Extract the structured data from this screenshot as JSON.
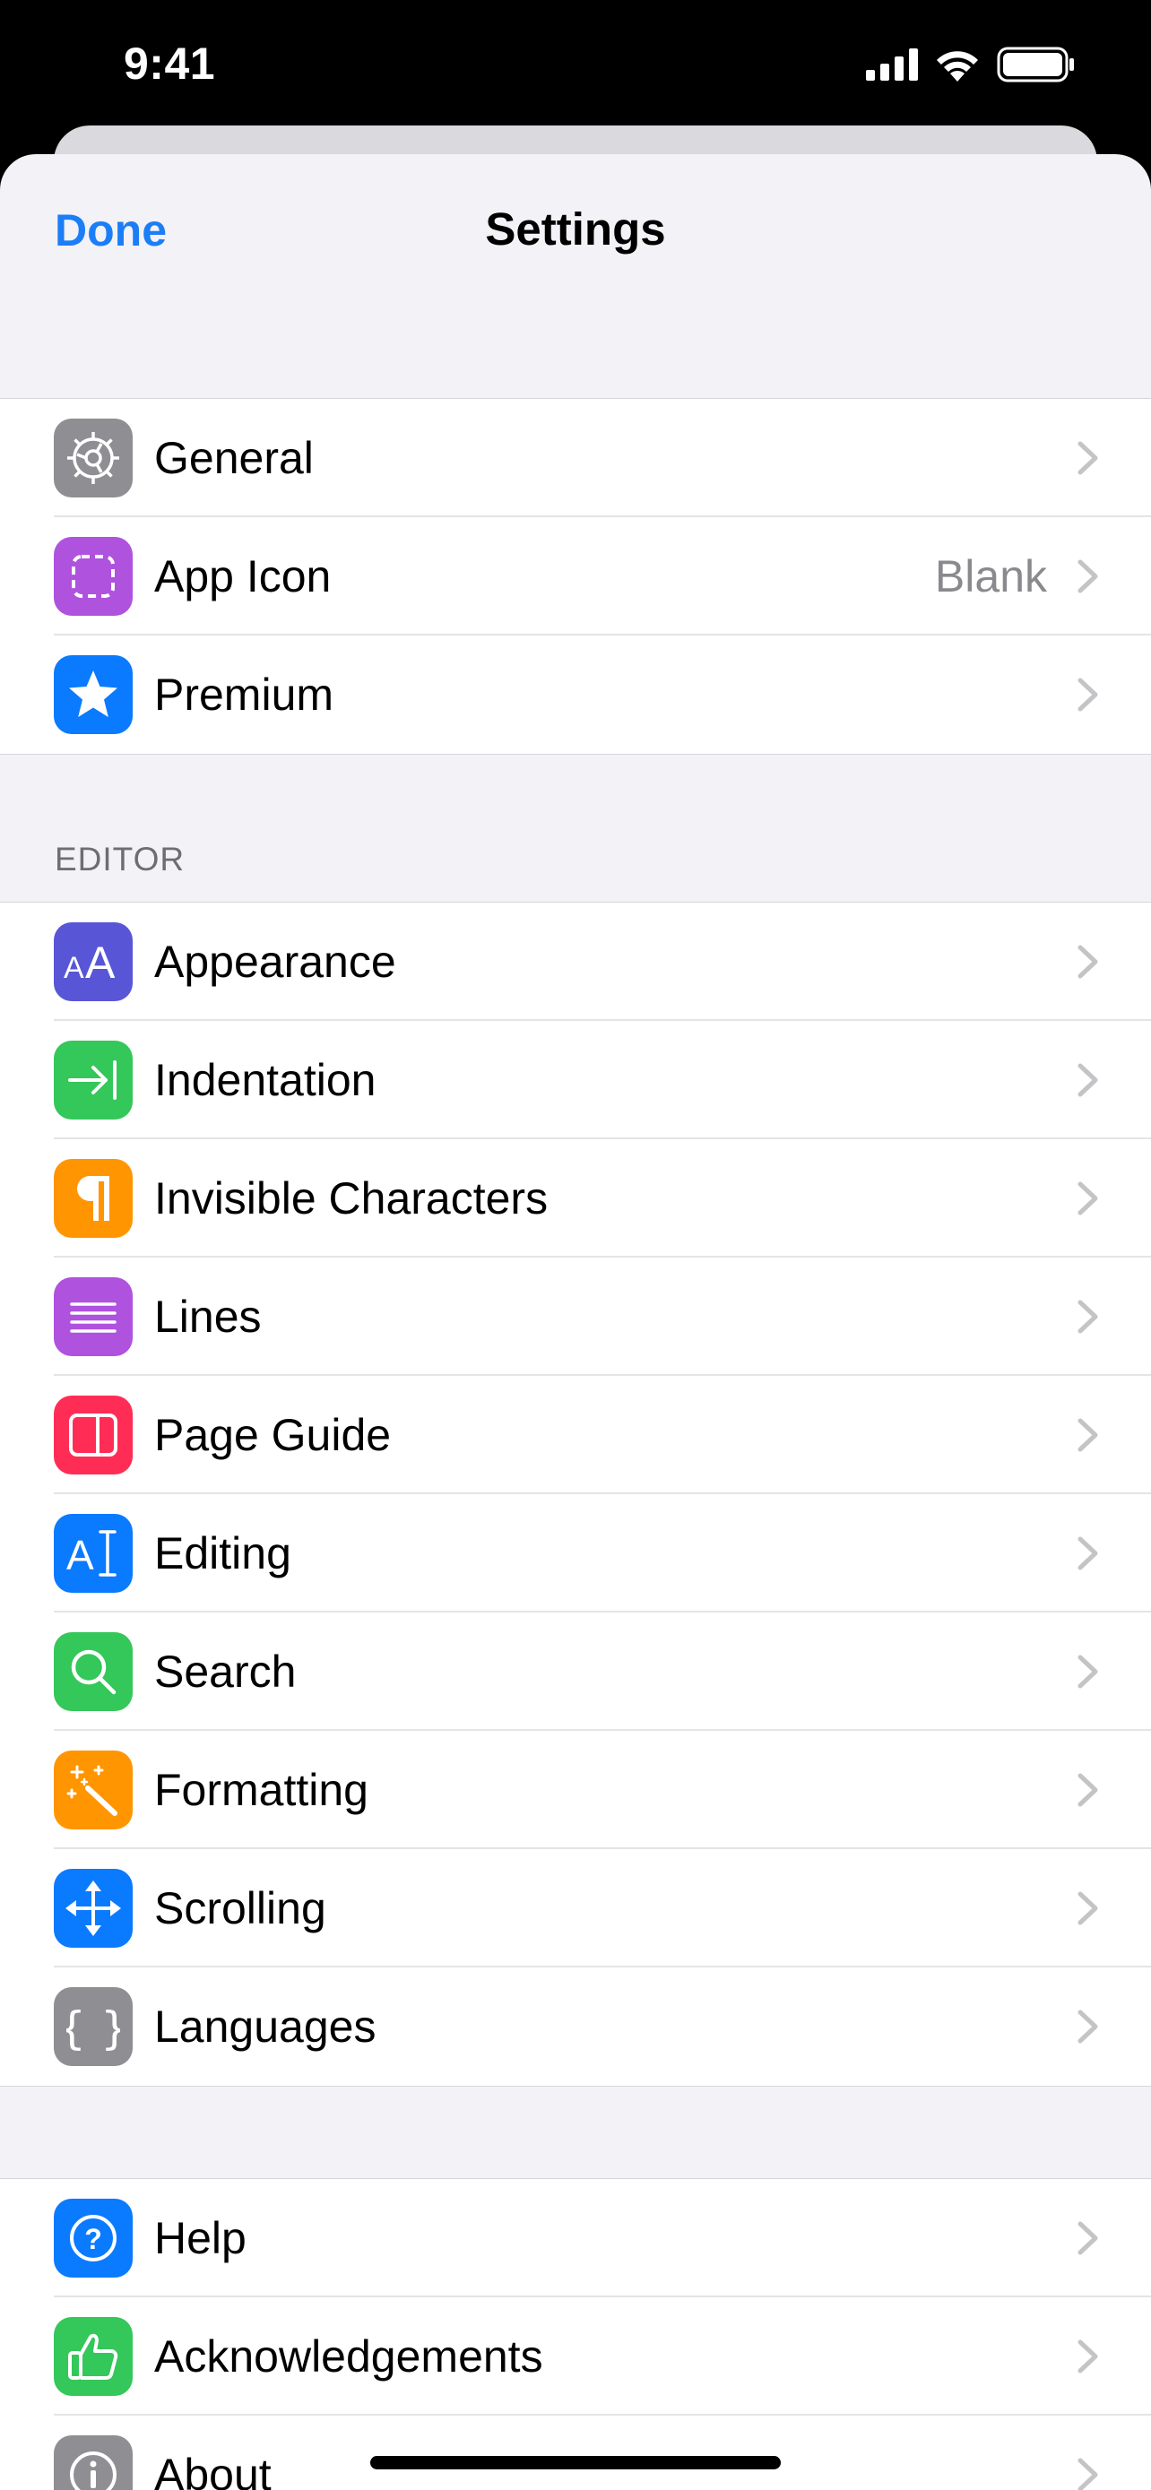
{
  "status_bar": {
    "time": "9:41"
  },
  "nav": {
    "done_label": "Done",
    "title": "Settings"
  },
  "groups": [
    {
      "items": [
        {
          "label": "General",
          "icon": "gear-icon",
          "color": "#8e8e93",
          "value": ""
        },
        {
          "label": "App Icon",
          "icon": "dashed-square-icon",
          "color": "#af52de",
          "value": "Blank"
        },
        {
          "label": "Premium",
          "icon": "star-icon",
          "color": "#0a7aff",
          "value": ""
        }
      ]
    },
    {
      "header": "EDITOR",
      "items": [
        {
          "label": "Appearance",
          "icon": "text-size-icon",
          "color": "#5856d6"
        },
        {
          "label": "Indentation",
          "icon": "arrow-to-line-icon",
          "color": "#34c759"
        },
        {
          "label": "Invisible Characters",
          "icon": "pilcrow-icon",
          "color": "#ff9500"
        },
        {
          "label": "Lines",
          "icon": "lines-icon",
          "color": "#af52de"
        },
        {
          "label": "Page Guide",
          "icon": "page-guide-icon",
          "color": "#ff2d55"
        },
        {
          "label": "Editing",
          "icon": "text-cursor-icon",
          "color": "#0a7aff"
        },
        {
          "label": "Search",
          "icon": "magnifying-glass-icon",
          "color": "#34c759"
        },
        {
          "label": "Formatting",
          "icon": "magic-wand-icon",
          "color": "#ff9500"
        },
        {
          "label": "Scrolling",
          "icon": "move-arrows-icon",
          "color": "#0a7aff"
        },
        {
          "label": "Languages",
          "icon": "curly-braces-icon",
          "color": "#8e8e93"
        }
      ]
    },
    {
      "items": [
        {
          "label": "Help",
          "icon": "question-circle-icon",
          "color": "#0a7aff"
        },
        {
          "label": "Acknowledgements",
          "icon": "thumbs-up-icon",
          "color": "#34c759"
        },
        {
          "label": "About",
          "icon": "info-circle-icon",
          "color": "#8e8e93"
        }
      ]
    }
  ]
}
